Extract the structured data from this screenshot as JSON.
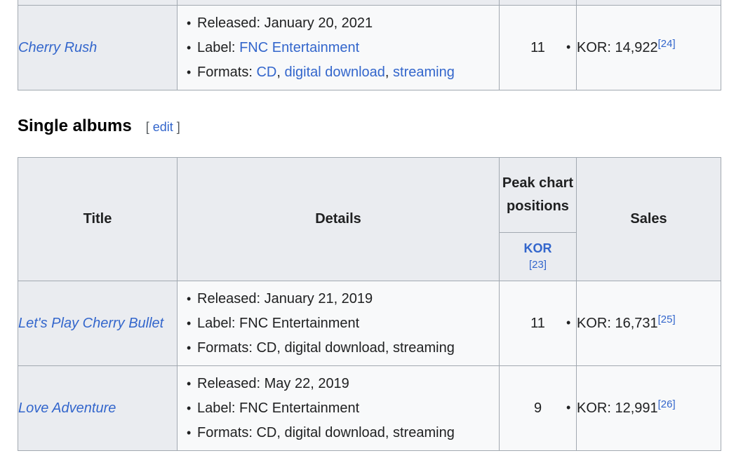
{
  "top_table": {
    "row": {
      "title": "Cherry Rush",
      "released": "Released: January 20, 2021",
      "label_prefix": "Label: ",
      "label_link": "FNC Entertainment",
      "formats_prefix": "Formats: ",
      "formats_cd": "CD",
      "formats_dd": "digital download",
      "formats_st": "streaming",
      "sep": ", ",
      "peak": "11",
      "sales": "KOR: 14,922",
      "sales_ref": "[24]"
    }
  },
  "section": {
    "heading": "Single albums",
    "edit_open": "[ ",
    "edit_label": "edit",
    "edit_close": " ]"
  },
  "table": {
    "headers": {
      "title": "Title",
      "details": "Details",
      "peak": "Peak chart positions",
      "kor": "KOR",
      "kor_ref": "[23]",
      "sales": "Sales"
    },
    "rows": [
      {
        "title": "Let's Play Cherry Bullet",
        "released": "Released: January 21, 2019",
        "label": "Label: FNC Entertainment",
        "formats": "Formats: CD, digital download, streaming",
        "peak": "11",
        "sales": "KOR: 16,731",
        "sales_ref": "[25]"
      },
      {
        "title": "Love Adventure",
        "released": "Released: May 22, 2019",
        "label": "Label: FNC Entertainment",
        "formats": "Formats: CD, digital download, streaming",
        "peak": "9",
        "sales": "KOR: 12,991",
        "sales_ref": "[26]"
      }
    ]
  }
}
